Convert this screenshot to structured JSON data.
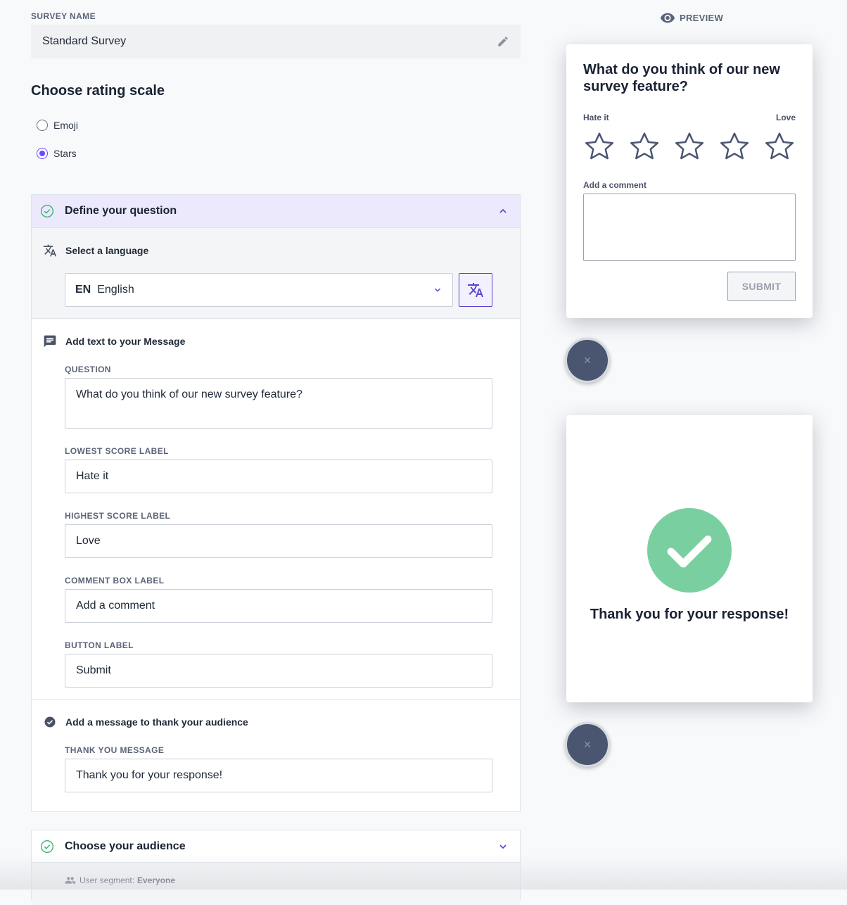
{
  "survey_name": {
    "label": "SURVEY NAME",
    "value": "Standard Survey",
    "edit_icon": "pencil-icon"
  },
  "rating_scale": {
    "title": "Choose rating scale",
    "options": [
      {
        "label": "Emoji",
        "selected": false
      },
      {
        "label": "Stars",
        "selected": true
      }
    ]
  },
  "define_question": {
    "title": "Define your question",
    "status_icon": "check-circle-icon",
    "expanded": true,
    "language": {
      "title": "Select a language",
      "code": "EN",
      "name": "English",
      "icon": "translate-icon"
    },
    "message": {
      "title": "Add text to your Message",
      "icon": "message-icon",
      "fields": [
        {
          "label": "QUESTION",
          "value": "What do you think of our new survey feature?"
        },
        {
          "label": "LOWEST SCORE LABEL",
          "value": "Hate it"
        },
        {
          "label": "HIGHEST SCORE LABEL",
          "value": "Love"
        },
        {
          "label": "COMMENT BOX LABEL",
          "value": "Add a comment"
        },
        {
          "label": "BUTTON LABEL",
          "value": "Submit"
        }
      ]
    },
    "thanks": {
      "title": "Add a message to thank your audience",
      "icon": "check-circle-filled-icon",
      "field_label": "THANK YOU MESSAGE",
      "field_value": "Thank you for your response!"
    }
  },
  "audience": {
    "title": "Choose your audience",
    "segment_label": "User segment:",
    "segment_value": "Everyone"
  },
  "preview": {
    "label": "PREVIEW",
    "question": "What do you think of our new survey feature?",
    "low_label": "Hate it",
    "high_label": "Love",
    "star_count": 5,
    "comment_label": "Add a comment",
    "submit_label": "SUBMIT",
    "close_glyph": "×",
    "thanks_message": "Thank you for your response!"
  },
  "colors": {
    "accent": "#6c47ff",
    "success": "#7acfa1",
    "header_bg": "#ebe9fb"
  }
}
